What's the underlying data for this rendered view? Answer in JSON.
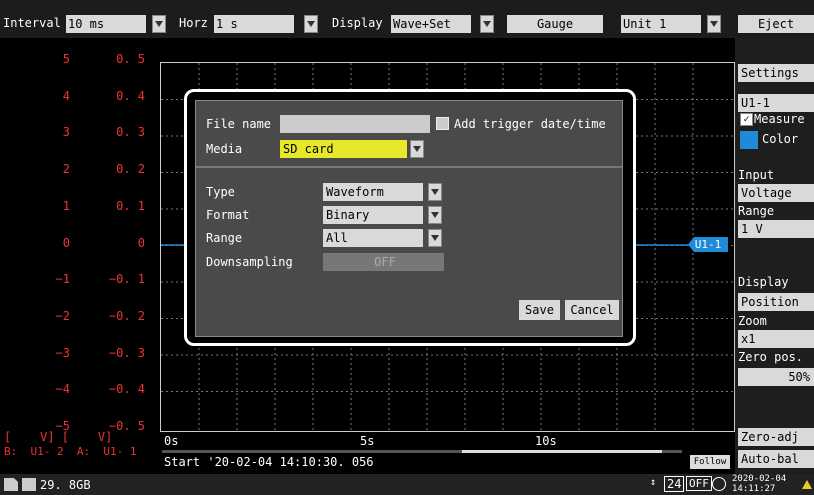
{
  "toolbar": {
    "interval_label": "Interval",
    "interval_value": "10 ms",
    "horz_label": "Horz",
    "horz_value": "1 s",
    "display_label": "Display",
    "display_value": "Wave+Set",
    "gauge_label": "Gauge",
    "unit_value": "Unit 1",
    "eject_label": "Eject"
  },
  "scale": {
    "a_values": [
      "5",
      "4",
      "3",
      "2",
      "1",
      "0",
      "−1",
      "−2",
      "−3",
      "−4",
      "−5"
    ],
    "b_values": [
      "0. 5",
      "0. 4",
      "0. 3",
      "0. 2",
      "0. 1",
      "0",
      "−0. 1",
      "−0. 2",
      "−0. 3",
      "−0. 4",
      "−0. 5"
    ],
    "units_line": "[    V] [    V]",
    "channels_line": "B:  U1- 2  A:  U1- 1"
  },
  "plot": {
    "marker": "U1-1",
    "time_ticks": [
      "0s",
      "5s",
      "10s"
    ],
    "start_text": "Start '20-02-04 14:10:30. 056",
    "follow_label": "Follow"
  },
  "status": {
    "storage": "29. 8GB",
    "count": "24",
    "off": "OFF",
    "date": "2020-02-04",
    "time": "14:11:27"
  },
  "right_panel": {
    "settings_label": "Settings",
    "channel_value": "U1-1",
    "measure_label": "Measure",
    "color_label": "Color",
    "input_label": "Input",
    "input_value": "Voltage",
    "range_label": "Range",
    "range_value": "1 V",
    "display_label": "Display",
    "display_value": "Position",
    "zoom_label": "Zoom",
    "zoom_value": "x1",
    "zero_pos_label": "Zero pos.",
    "zero_pos_value": "50%",
    "zero_adj_label": "Zero-adj",
    "auto_bal_label": "Auto-bal"
  },
  "dialog": {
    "file_name_label": "File name",
    "file_name_value": "",
    "add_trigger_label": "Add trigger date/time",
    "media_label": "Media",
    "media_value": "SD card",
    "type_label": "Type",
    "type_value": "Waveform",
    "format_label": "Format",
    "format_value": "Binary",
    "range_label": "Range",
    "range_value": "All",
    "downsampling_label": "Downsampling",
    "downsampling_value": "OFF",
    "save_label": "Save",
    "cancel_label": "Cancel"
  },
  "colors": {
    "accent_blue": "#1f8bd8",
    "scale_red": "#e33333",
    "media_yellow": "#e8e82a",
    "dialog_bg": "#4a4a4a"
  }
}
